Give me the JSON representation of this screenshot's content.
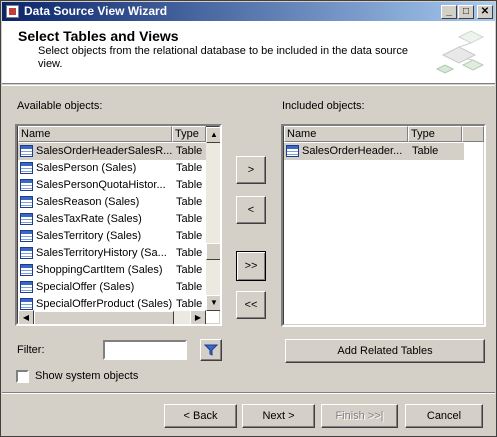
{
  "window": {
    "title": "Data Source View Wizard",
    "controls": {
      "minimize": "_",
      "maximize": "□",
      "close": "✕"
    }
  },
  "header": {
    "title": "Select Tables and Views",
    "description": "Select objects from the relational database to be included in the data source view."
  },
  "available": {
    "label": "Available objects:",
    "col_name": "Name",
    "col_type": "Type",
    "rows": [
      {
        "name": "SalesOrderHeaderSalesR...",
        "type": "Table"
      },
      {
        "name": "SalesPerson (Sales)",
        "type": "Table"
      },
      {
        "name": "SalesPersonQuotaHistor...",
        "type": "Table"
      },
      {
        "name": "SalesReason (Sales)",
        "type": "Table"
      },
      {
        "name": "SalesTaxRate (Sales)",
        "type": "Table"
      },
      {
        "name": "SalesTerritory (Sales)",
        "type": "Table"
      },
      {
        "name": "SalesTerritoryHistory (Sa...",
        "type": "Table"
      },
      {
        "name": "ShoppingCartItem (Sales)",
        "type": "Table"
      },
      {
        "name": "SpecialOffer (Sales)",
        "type": "Table"
      },
      {
        "name": "SpecialOfferProduct (Sales)",
        "type": "Table"
      }
    ]
  },
  "included": {
    "label": "Included objects:",
    "col_name": "Name",
    "col_type": "Type",
    "rows": [
      {
        "name": "SalesOrderHeader...",
        "type": "Table"
      }
    ]
  },
  "transfer": {
    "add": ">",
    "remove": "<",
    "add_all": ">>",
    "remove_all": "<<"
  },
  "filter": {
    "label": "Filter:",
    "value": ""
  },
  "add_related": "Add Related Tables",
  "show_system": "Show system objects",
  "footer": {
    "back": "< Back",
    "next": "Next >",
    "finish": "Finish >>|",
    "cancel": "Cancel"
  }
}
